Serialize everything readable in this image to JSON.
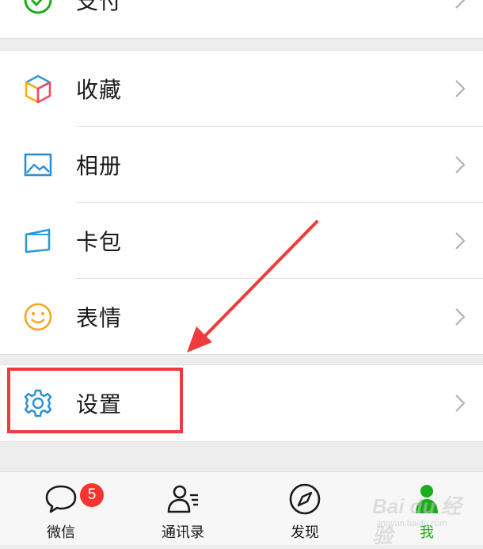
{
  "menu": {
    "partial_top": {
      "label": "支付"
    },
    "items": [
      {
        "label": "收藏"
      },
      {
        "label": "相册"
      },
      {
        "label": "卡包"
      },
      {
        "label": "表情"
      }
    ],
    "settings": {
      "label": "设置"
    }
  },
  "tabs": [
    {
      "label": "微信",
      "badge": "5"
    },
    {
      "label": "通讯录"
    },
    {
      "label": "发现"
    },
    {
      "label": "我",
      "active": true
    }
  ],
  "watermark": {
    "text": "Bai du 经验",
    "sub": "jingyan.baidu.com"
  },
  "colors": {
    "accent_green": "#1aad19",
    "badge_red": "#f43530",
    "annotation_red": "#ef3b3b"
  }
}
